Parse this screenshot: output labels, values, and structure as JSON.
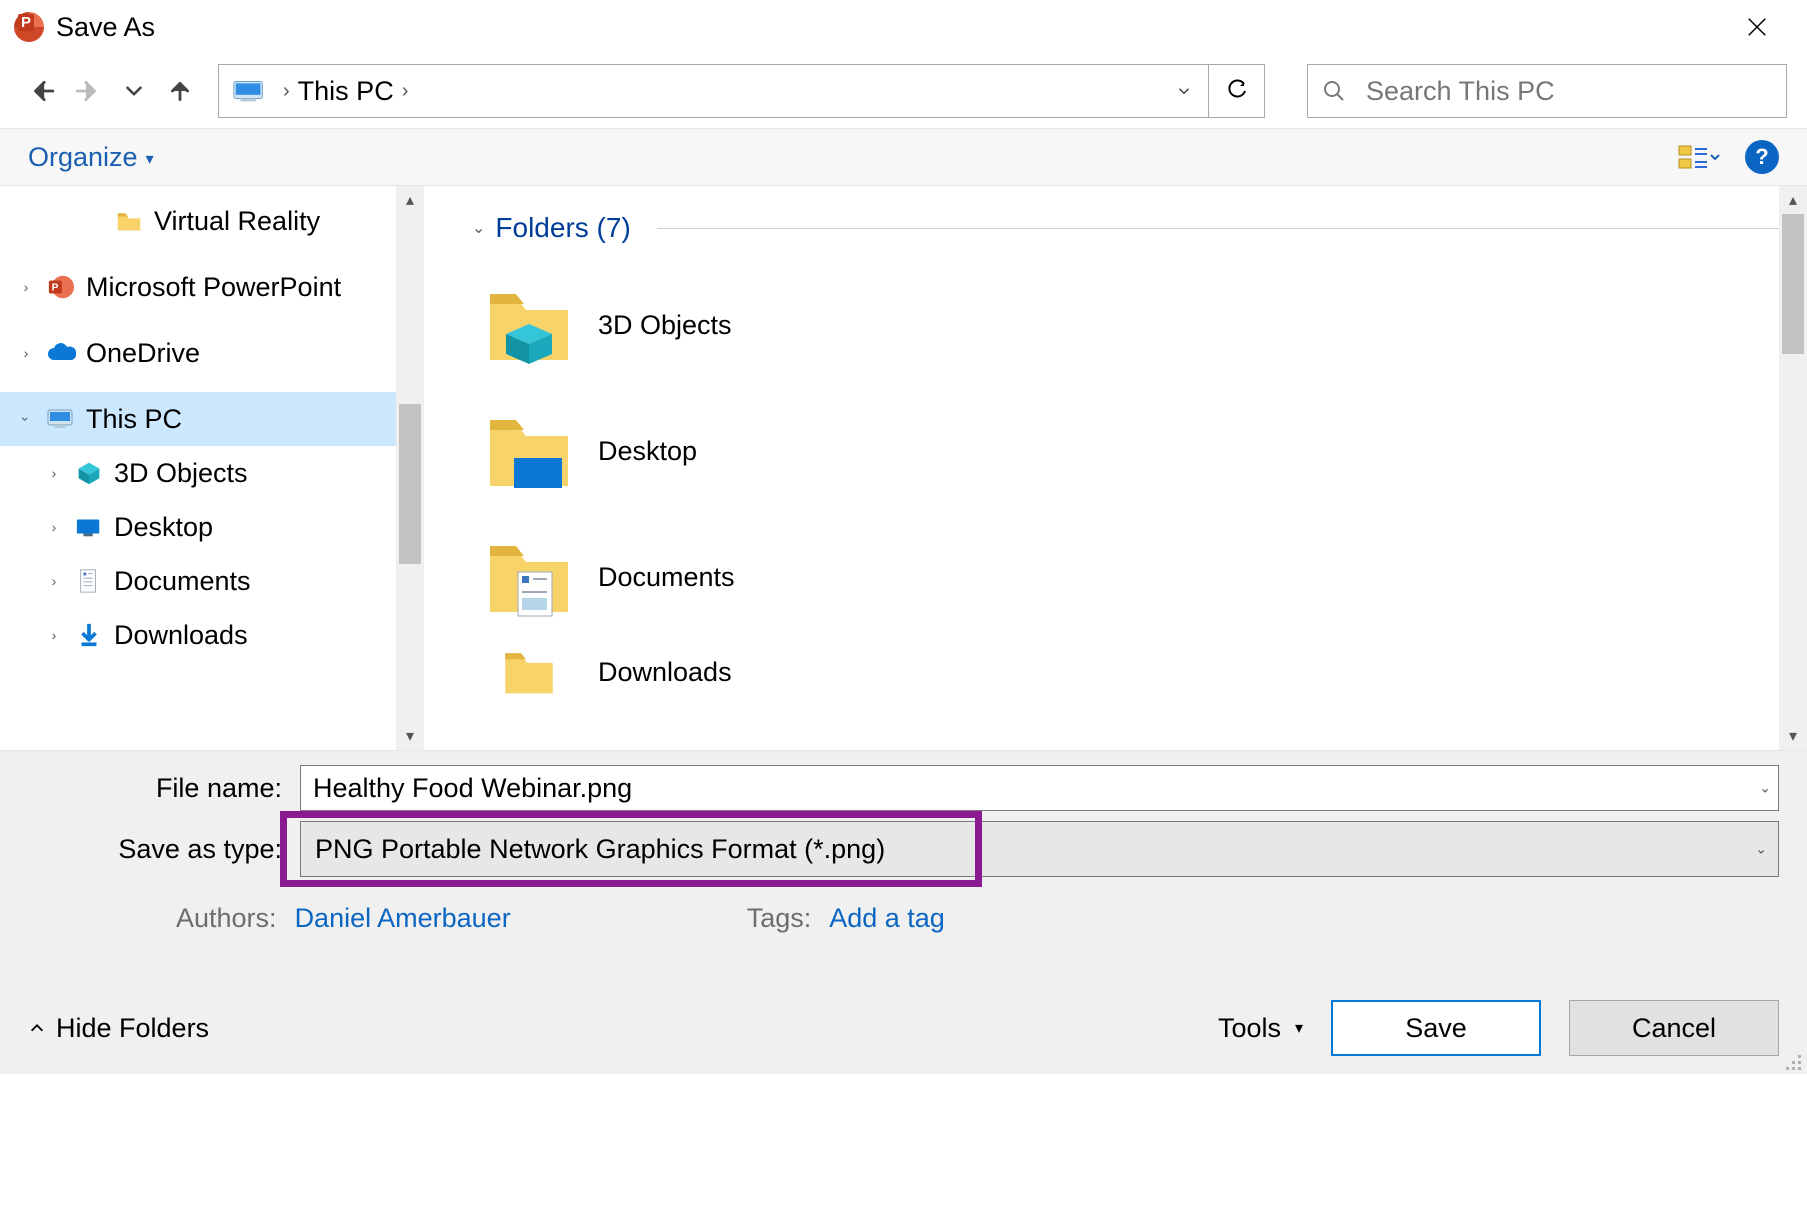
{
  "titlebar": {
    "title": "Save As"
  },
  "nav": {
    "breadcrumb_text": "This PC",
    "search_placeholder": "Search This PC"
  },
  "toolbar": {
    "organize_label": "Organize"
  },
  "tree": {
    "items": [
      {
        "label": "Virtual Reality"
      },
      {
        "label": "Microsoft PowerPoint"
      },
      {
        "label": "OneDrive"
      },
      {
        "label": "This PC"
      },
      {
        "label": "3D Objects"
      },
      {
        "label": "Desktop"
      },
      {
        "label": "Documents"
      },
      {
        "label": "Downloads"
      }
    ]
  },
  "content": {
    "section_label": "Folders (7)",
    "folders": [
      {
        "label": "3D Objects"
      },
      {
        "label": "Desktop"
      },
      {
        "label": "Documents"
      },
      {
        "label": "Downloads"
      }
    ]
  },
  "form": {
    "filename_label": "File name:",
    "filename_value": "Healthy Food Webinar.png",
    "type_label": "Save as type:",
    "type_value": "PNG Portable Network Graphics Format (*.png)",
    "authors_label": "Authors:",
    "authors_value": "Daniel Amerbauer",
    "tags_label": "Tags:",
    "tags_value": "Add a tag"
  },
  "footer": {
    "hide_folders": "Hide Folders",
    "tools": "Tools",
    "save": "Save",
    "cancel": "Cancel"
  }
}
